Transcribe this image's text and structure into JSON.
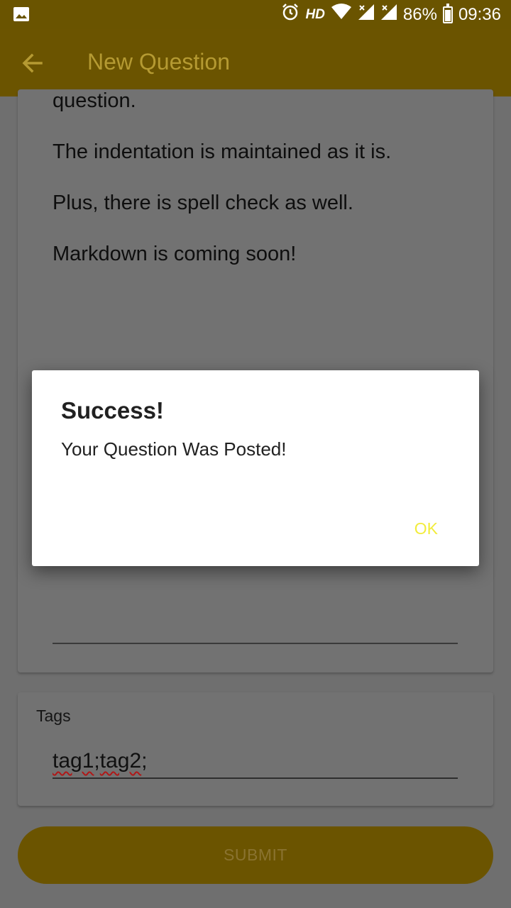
{
  "status_bar": {
    "hd": "HD",
    "battery": "86%",
    "time": "09:36",
    "icons": [
      "image-icon",
      "alarm-icon",
      "wifi-icon",
      "signal-icon",
      "signal-icon",
      "battery-icon"
    ]
  },
  "app_bar": {
    "title": "New Question",
    "back_icon": "arrow-back-icon"
  },
  "question_body": {
    "lines": [
      "question.",
      "The indentation is maintained as it is.",
      "Plus, there is spell check as well.",
      "Markdown is coming soon!"
    ]
  },
  "tags": {
    "label": "Tags",
    "parts": [
      "tag1",
      ";",
      "tag2",
      ";"
    ]
  },
  "submit": {
    "label": "SUBMIT"
  },
  "dialog": {
    "title": "Success!",
    "message": "Your Question Was Posted!",
    "ok_label": "OK"
  },
  "colors": {
    "primary_dark": "#6a5400",
    "accent": "#f2ec3c",
    "scrim_background": "#6f6f6f"
  }
}
